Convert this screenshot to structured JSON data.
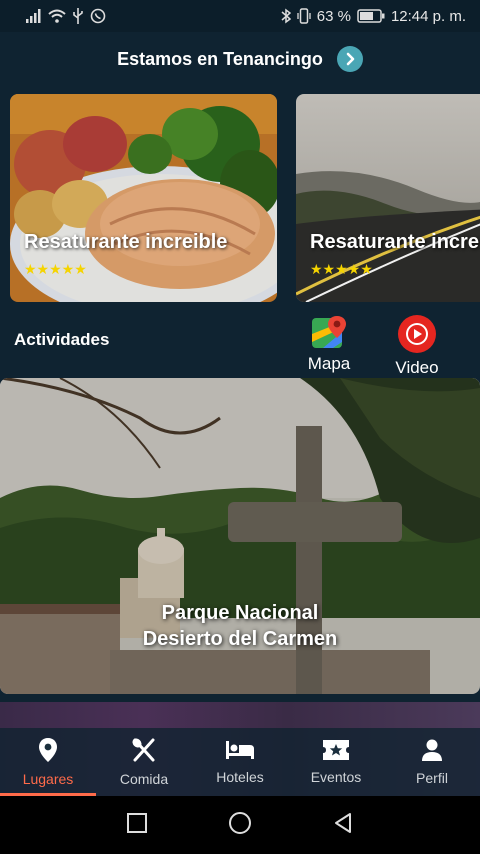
{
  "status": {
    "battery_percent": "63 %",
    "time": "12:44 p. m."
  },
  "header": {
    "title": "Estamos en Tenancingo"
  },
  "cards": [
    {
      "title": "Resaturante increible",
      "stars": "★★★★★"
    },
    {
      "title": "Resaturante incre",
      "stars": "★★★★★"
    }
  ],
  "activities": {
    "label": "Actividades",
    "map_label": "Mapa",
    "video_label": "Video"
  },
  "feature": {
    "title_line1": "Parque Nacional",
    "title_line2": "Desierto del Carmen"
  },
  "nav": {
    "items": [
      {
        "label": "Lugares",
        "icon": "location-pin-icon",
        "active": true
      },
      {
        "label": "Comida",
        "icon": "utensils-icon",
        "active": false
      },
      {
        "label": "Hoteles",
        "icon": "bed-icon",
        "active": false
      },
      {
        "label": "Eventos",
        "icon": "ticket-icon",
        "active": false
      },
      {
        "label": "Perfil",
        "icon": "person-icon",
        "active": false
      }
    ]
  },
  "colors": {
    "background": "#0f2331",
    "accent": "#ff6b4a",
    "chevron": "#4aa6b5",
    "stars": "#f5d400",
    "video_red": "#e52620"
  }
}
